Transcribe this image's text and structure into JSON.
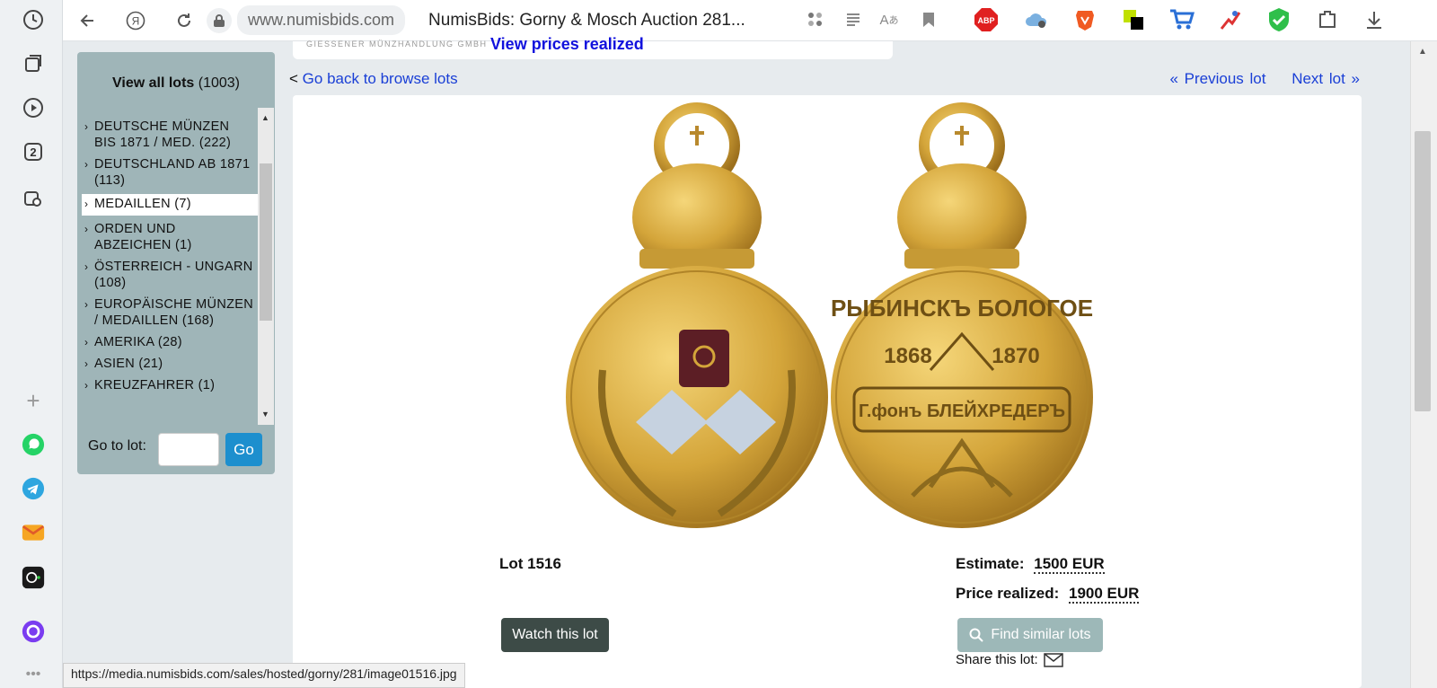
{
  "browser": {
    "url": "www.numisbids.com",
    "tab_title": "NumisBids: Gorny & Mosch Auction 281...",
    "side_badge": "2",
    "status_url": "https://media.numisbids.com/sales/hosted/gorny/281/image01516.jpg"
  },
  "header": {
    "mint_text": "GIESSENER MÜNZHANDLUNG GMBH",
    "prices_link": "View prices realized"
  },
  "sidebar": {
    "view_all_label": "View all lots",
    "view_all_count": "(1003)",
    "categories": [
      {
        "label": "DEUTSCHE MÜNZEN BIS 1871 / MED. (222)",
        "active": false
      },
      {
        "label": "DEUTSCHLAND AB 1871 (113)",
        "active": false
      },
      {
        "label": "MEDAILLEN (7)",
        "active": true
      },
      {
        "label": "ORDEN UND ABZEICHEN (1)",
        "active": false
      },
      {
        "label": "ÖSTERREICH - UNGARN (108)",
        "active": false
      },
      {
        "label": "EUROPÄISCHE MÜNZEN / MEDAILLEN (168)",
        "active": false
      },
      {
        "label": "AMERIKA (28)",
        "active": false
      },
      {
        "label": "ASIEN (21)",
        "active": false
      },
      {
        "label": "KREUZFAHRER (1)",
        "active": false
      }
    ],
    "goto_label": "Go to lot:",
    "goto_placeholder": "",
    "go_button": "Go"
  },
  "nav": {
    "back_prefix": "<",
    "back_link": "Go back to browse lots",
    "previous": "« Previous lot",
    "next": "Next lot »"
  },
  "lot": {
    "number_label": "Lot 1516",
    "estimate_label": "Estimate:",
    "estimate_value": "1500 EUR",
    "price_label": "Price realized:",
    "price_value": "1900 EUR",
    "watch_button": "Watch this lot",
    "find_button": "Find similar lots",
    "share_label": "Share this lot:"
  },
  "medal": {
    "reverse_top": "РЫБИНСКЪ БОЛОГОЕ",
    "year_left": "1868",
    "year_right": "1870",
    "reverse_center": "Г.фонъ БЛЕЙХРЕДЕРЪ"
  },
  "colors": {
    "link": "#1a3fd6",
    "panel": "#9fb5b8",
    "go_button": "#1d8fce",
    "watch_button": "#3d4b47",
    "gold": "#d4a53a"
  }
}
